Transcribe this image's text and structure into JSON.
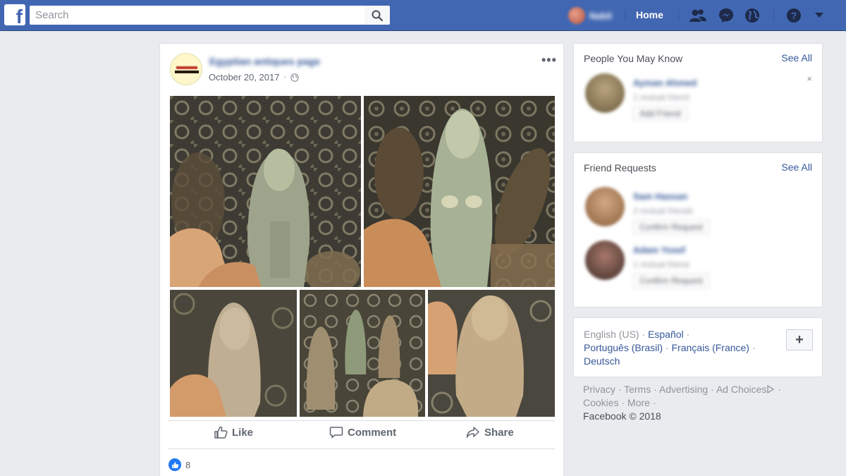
{
  "topbar": {
    "logo": "f",
    "search_placeholder": "Search",
    "home_label": "Home",
    "profile_name": "Nabil"
  },
  "post": {
    "page_name": "Egyptian antiques page",
    "date": "October 20, 2017",
    "more": "•••",
    "actions": {
      "like": "Like",
      "comment": "Comment",
      "share": "Share"
    },
    "reaction_count": "8"
  },
  "people_you_may_know": {
    "title": "People You May Know",
    "see_all": "See All",
    "close": "×",
    "person": {
      "name": "Ayman Ahmed",
      "mutual": "1 mutual friend",
      "button": "Add Friend"
    }
  },
  "friend_requests": {
    "title": "Friend Requests",
    "see_all": "See All",
    "people": [
      {
        "name": "Sam Hassan",
        "mutual": "2 mutual friends",
        "button": "Confirm Request"
      },
      {
        "name": "Adam Yosef",
        "mutual": "1 mutual friend",
        "button": "Confirm Request"
      }
    ]
  },
  "languages": {
    "current": "English (US)",
    "links": [
      "Español",
      "Português (Brasil)",
      "Français (France)",
      "Deutsch"
    ],
    "plus": "+"
  },
  "footer": {
    "links": [
      "Privacy",
      "Terms",
      "Advertising",
      "Ad Choices",
      "Cookies",
      "More"
    ],
    "copyright": "Facebook © 2018"
  },
  "colors": {
    "brand_blue": "#4267b2",
    "link_blue": "#365899",
    "like_blue": "#2078f4",
    "page_bg": "#e9ebee"
  }
}
